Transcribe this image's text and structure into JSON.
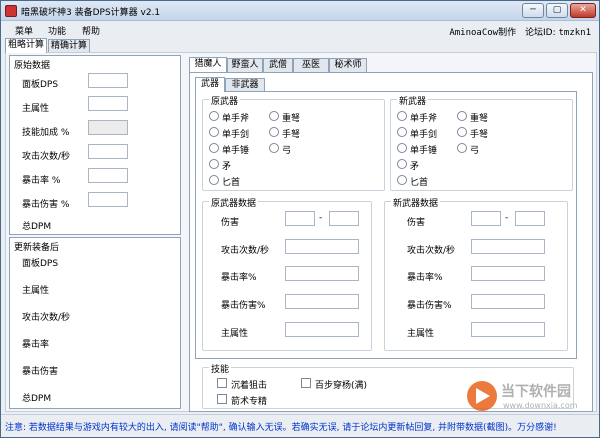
{
  "window": {
    "title": "暗黑破坏神3 装备DPS计算器 v2.1",
    "controls": {
      "minimize": "─",
      "maximize": "▢",
      "close": "✕"
    }
  },
  "menu": {
    "items": [
      "菜单",
      "功能",
      "帮助"
    ]
  },
  "author": {
    "maker": "AminoaCow制作",
    "forum_label": "论坛ID:",
    "forum_id": "tmzkn1"
  },
  "main_tabs": [
    "粗略计算",
    "精确计算"
  ],
  "original_data": {
    "title": "原始数据",
    "fields": [
      "面板DPS",
      "主属性",
      "技能加成 %",
      "攻击次数/秒",
      "暴击率 %",
      "暴击伤害 %"
    ],
    "total": "总DPM"
  },
  "after_update": {
    "title": "更新装备后",
    "fields": [
      "面板DPS",
      "主属性",
      "攻击次数/秒",
      "暴击率",
      "暴击伤害",
      "总DPM"
    ]
  },
  "class_tabs": [
    "猎魔人",
    "野蛮人",
    "武僧",
    "巫医",
    "秘术师"
  ],
  "weapon_tabs": [
    "武器",
    "非武器"
  ],
  "weapon_type_original": {
    "title": "原武器",
    "col1": [
      "单手斧",
      "单手剑",
      "单手锤",
      "矛",
      "匕首"
    ],
    "col2": [
      "重弩",
      "手弩",
      "弓"
    ]
  },
  "weapon_type_new": {
    "title": "新武器",
    "col1": [
      "单手斧",
      "单手剑",
      "单手锤",
      "矛",
      "匕首"
    ],
    "col2": [
      "重弩",
      "手弩",
      "弓"
    ]
  },
  "weapon_data_original": {
    "title": "原武器数据",
    "damage": "伤害",
    "dash": "-",
    "fields": [
      "攻击次数/秒",
      "暴击率%",
      "暴击伤害%",
      "主属性"
    ]
  },
  "weapon_data_new": {
    "title": "新武器数据",
    "damage": "伤害",
    "dash": "-",
    "fields": [
      "攻击次数/秒",
      "暴击率%",
      "暴击伤害%",
      "主属性"
    ]
  },
  "skills": {
    "title": "技能",
    "items": [
      "沉着狙击",
      "百步穿杨(满)",
      "箭术专精"
    ]
  },
  "status": {
    "notice": "注意: 若数据结果与游戏内有较大的出入, 请阅读\"帮助\", 确认输入无误。若确实无误, 请于论坛内更新帖回复, 并附带数据(截图)。万分感谢!"
  },
  "watermark": {
    "brand": "当下软件园",
    "url": "www.downxia.com"
  }
}
